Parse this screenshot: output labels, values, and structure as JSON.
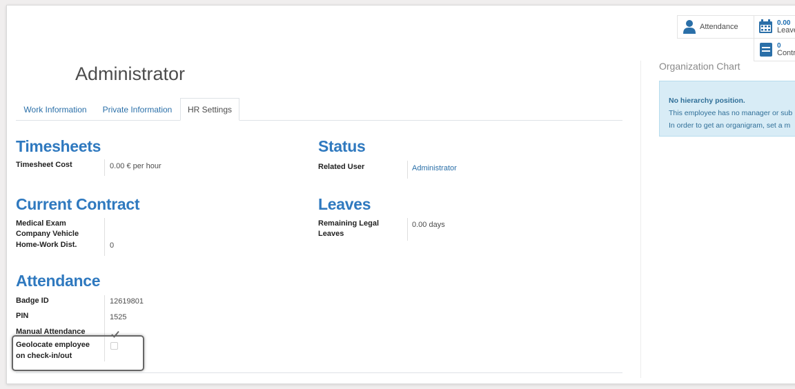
{
  "header": {
    "employee_name": "Administrator"
  },
  "smart_buttons": {
    "attendance": {
      "label": "Attendance",
      "icon": "user-icon"
    },
    "leaves": {
      "value": "0.00",
      "label": "Leave",
      "icon": "calendar-icon"
    },
    "contracts": {
      "value": "0",
      "label": "Contra",
      "icon": "contract-icon"
    }
  },
  "tabs": [
    {
      "label": "Work Information"
    },
    {
      "label": "Private Information"
    },
    {
      "label": "HR Settings"
    }
  ],
  "timesheets": {
    "title": "Timesheets",
    "cost_label": "Timesheet Cost",
    "cost_value": "0.00 € per hour"
  },
  "status": {
    "title": "Status",
    "related_user_label": "Related User",
    "related_user_value": "Administrator"
  },
  "current_contract": {
    "title": "Current Contract",
    "medical_exam_label": "Medical Exam",
    "company_vehicle_label": "Company Vehicle",
    "home_work_label": "Home-Work Dist.",
    "home_work_value": "0"
  },
  "leaves": {
    "title": "Leaves",
    "remaining_label_1": "Remaining Legal",
    "remaining_label_2": "Leaves",
    "remaining_value": "0.00 days"
  },
  "attendance": {
    "title": "Attendance",
    "badge_label": "Badge ID",
    "badge_value": "12619801",
    "pin_label": "PIN",
    "pin_value": "1525",
    "manual_label": "Manual Attendance",
    "manual_checked": true,
    "geolocate_label_1": "Geolocate employee",
    "geolocate_label_2": "on check-in/out",
    "geolocate_checked": false
  },
  "org_chart": {
    "title": "Organization Chart",
    "alert_title": "No hierarchy position.",
    "alert_line_1": "This employee has no manager or sub",
    "alert_line_2": "In order to get an organigram, set a m"
  },
  "colors": {
    "accent": "#2f79bf",
    "link": "#2a6fa8",
    "alert_bg": "#d8ecf6"
  }
}
